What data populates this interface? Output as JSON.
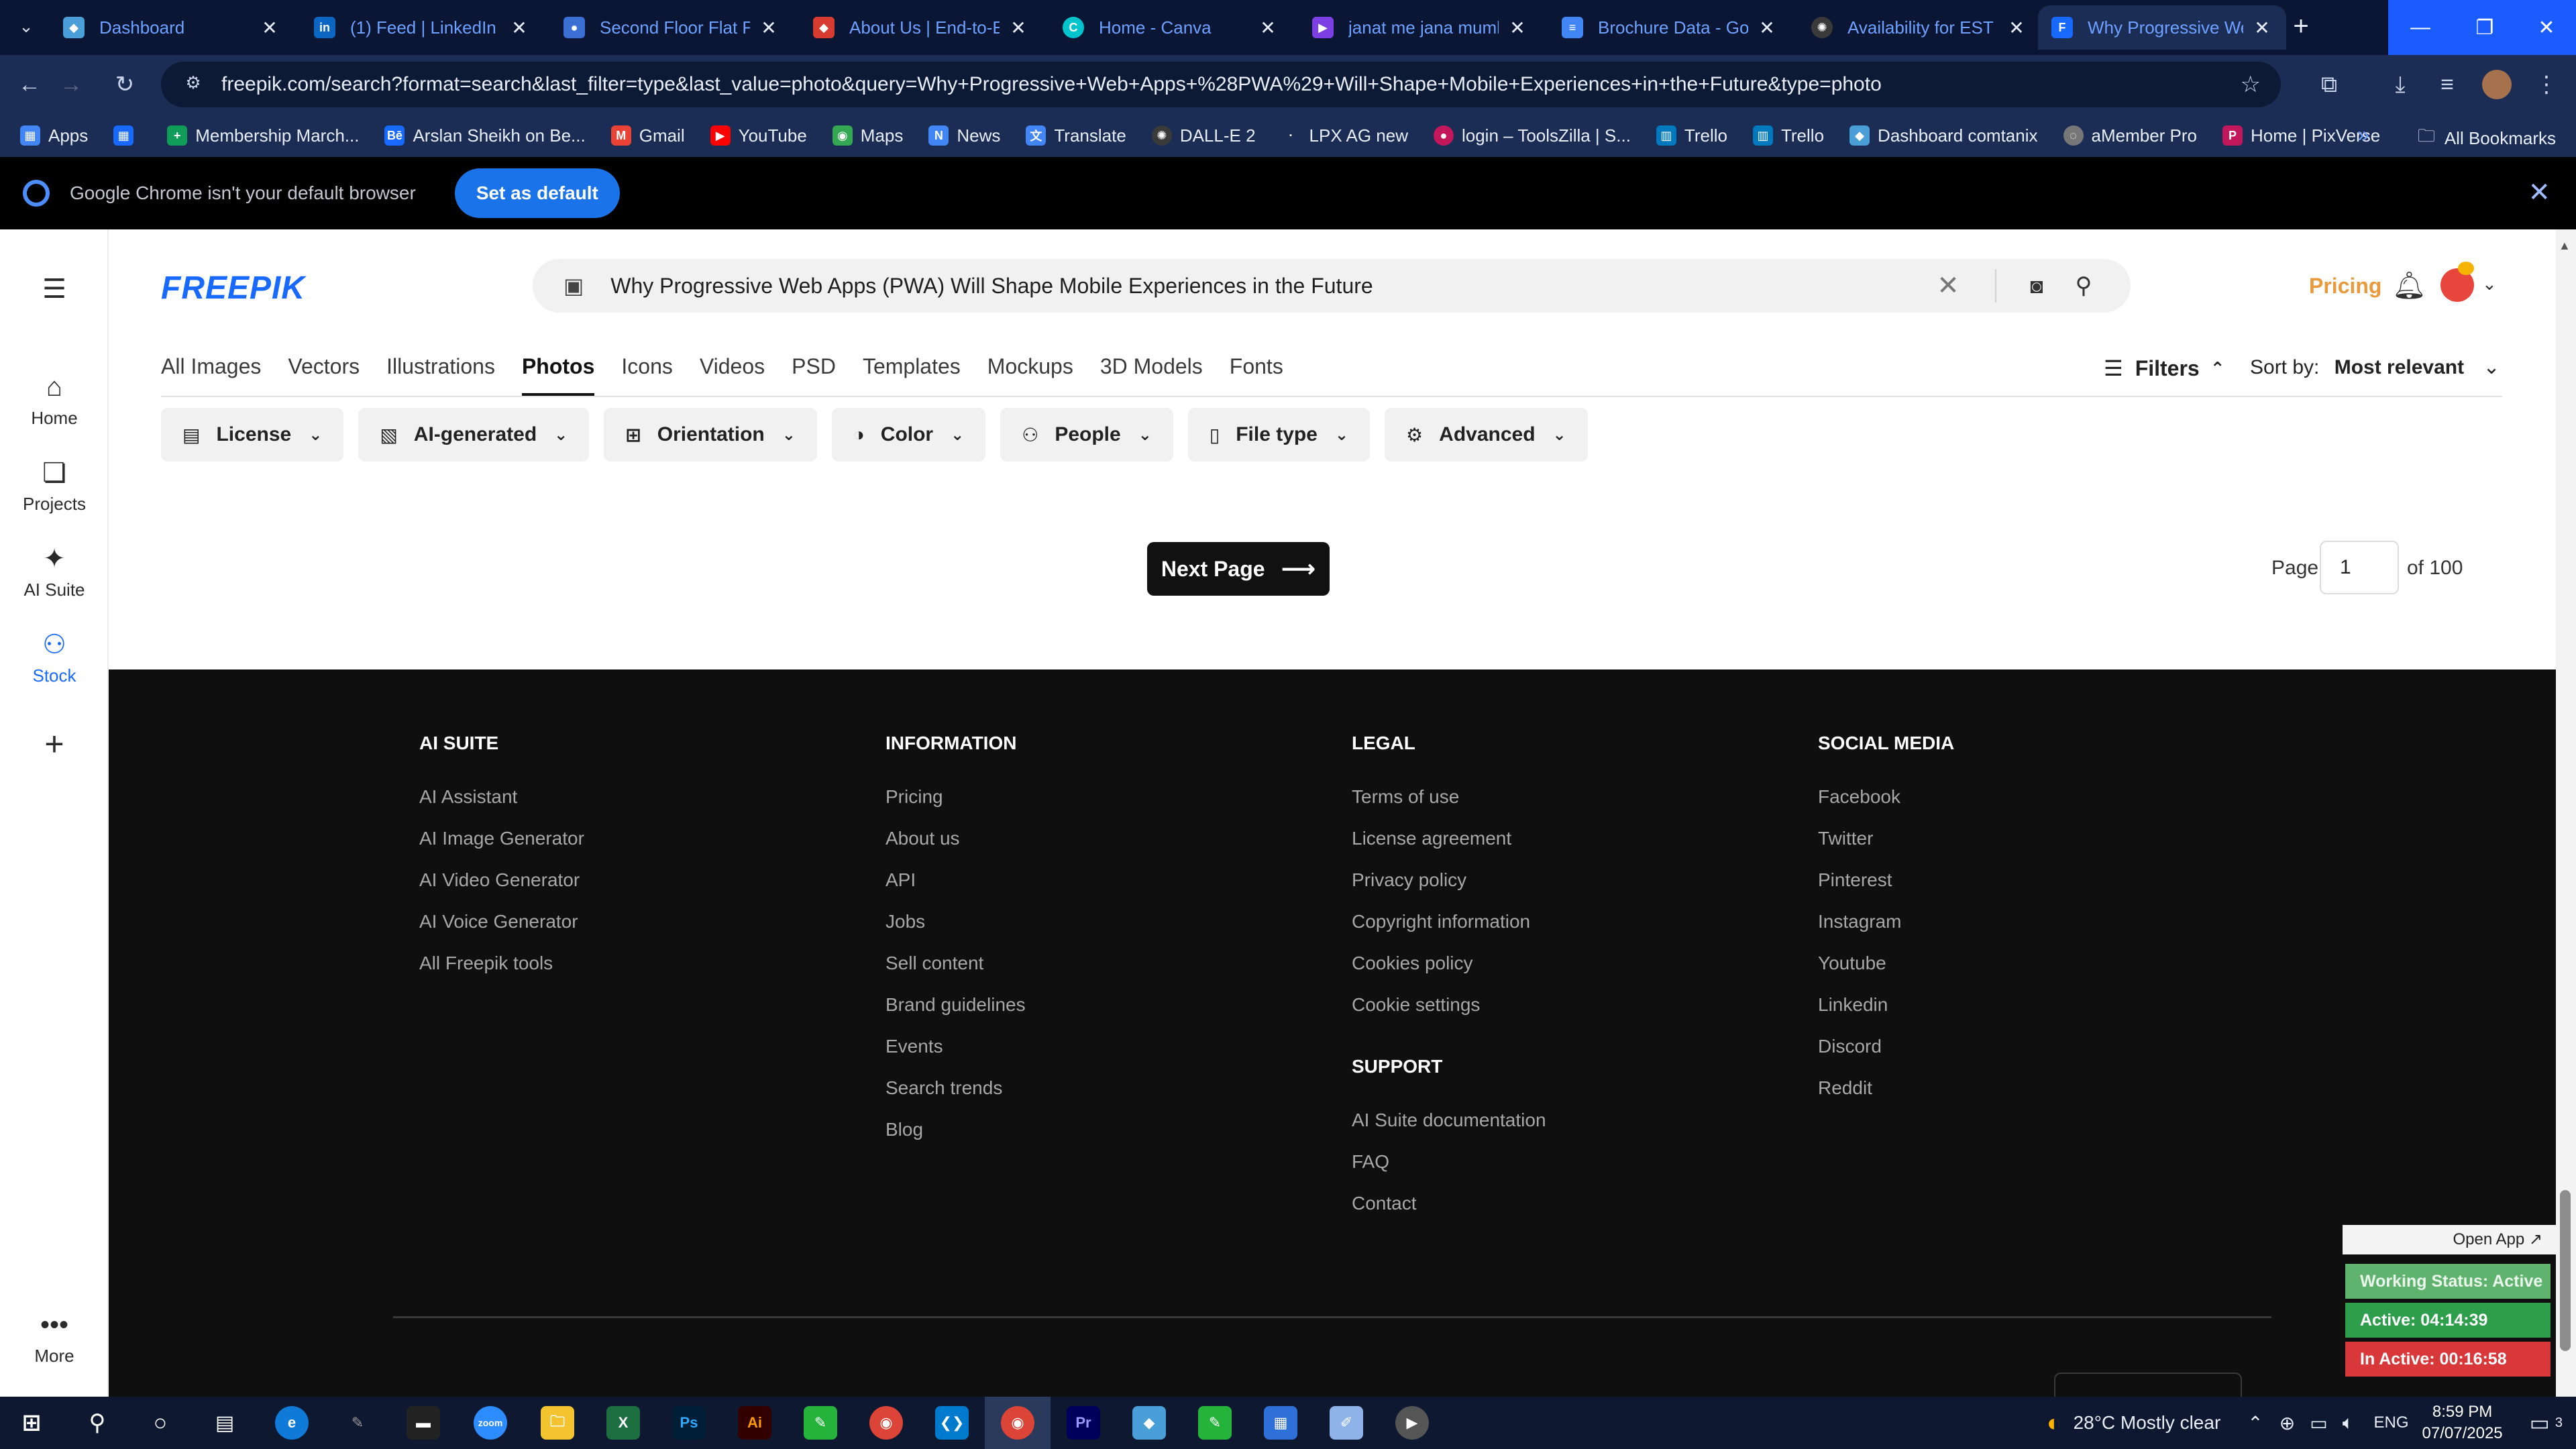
{
  "browser": {
    "tabs": [
      {
        "title": "Dashboard",
        "icon": "dashboard-favicon",
        "color": "#4a9fd8"
      },
      {
        "title": "(1) Feed | LinkedIn",
        "icon": "linkedin-favicon",
        "color": "#0a66c2"
      },
      {
        "title": "Second Floor Flat For",
        "icon": "listing-favicon",
        "color": "#3b6fd4"
      },
      {
        "title": "About Us | End-to-En",
        "icon": "site-favicon",
        "color": "#d83b2f"
      },
      {
        "title": "Home - Canva",
        "icon": "canva-favicon",
        "color": "#00c4cc"
      },
      {
        "title": "janat me jana mumki",
        "icon": "video-favicon",
        "color": "#7b3fe4"
      },
      {
        "title": "Brochure Data - Goo",
        "icon": "docs-favicon",
        "color": "#4285f4"
      },
      {
        "title": "Availability for EST sh",
        "icon": "openai-favicon",
        "color": "#3a3a3a"
      },
      {
        "title": "Why Progressive We",
        "icon": "freepik-favicon",
        "color": "#1769ff"
      }
    ],
    "url": "freepik.com/search?format=search&last_filter=type&last_value=photo&query=Why+Progressive+Web+Apps+%28PWA%29+Will+Shape+Mobile+Experiences+in+the+Future&type=photo",
    "bookmarks": [
      {
        "label": "Apps",
        "icon": "apps-grid-icon",
        "color": "#4285f4"
      },
      {
        "label": "",
        "icon": "grid-icon",
        "color": "#1769ff"
      },
      {
        "label": "Membership March...",
        "icon": "membership-icon",
        "color": "#0f9d58"
      },
      {
        "label": "Arslan Sheikh on Be...",
        "icon": "behance-icon",
        "color": "#1769ff"
      },
      {
        "label": "Gmail",
        "icon": "gmail-icon",
        "color": "#ea4335"
      },
      {
        "label": "YouTube",
        "icon": "youtube-icon",
        "color": "#ff0000"
      },
      {
        "label": "Maps",
        "icon": "maps-icon",
        "color": "#34a853"
      },
      {
        "label": "News",
        "icon": "news-icon",
        "color": "#4285f4"
      },
      {
        "label": "Translate",
        "icon": "translate-icon",
        "color": "#4285f4"
      },
      {
        "label": "DALL-E 2",
        "icon": "openai-icon",
        "color": "#3a3a3a"
      },
      {
        "label": "LPX AG new",
        "icon": "lpx-icon",
        "color": "#1b2d55"
      },
      {
        "label": "login – ToolsZilla | S...",
        "icon": "toolszilla-icon",
        "color": "#c2185b"
      },
      {
        "label": "Trello",
        "icon": "trello-icon",
        "color": "#0079bf"
      },
      {
        "label": "Trello",
        "icon": "trello-icon",
        "color": "#0079bf"
      },
      {
        "label": "Dashboard comtanix",
        "icon": "dashboard-icon",
        "color": "#4a9fd8"
      },
      {
        "label": "aMember Pro",
        "icon": "amember-icon",
        "color": "#777777"
      },
      {
        "label": "Home | PixVerse",
        "icon": "pixverse-icon",
        "color": "#c2185b"
      }
    ],
    "all_bookmarks": "All Bookmarks",
    "infobar": {
      "message": "Google Chrome isn't your default browser",
      "button": "Set as default"
    }
  },
  "rail": {
    "items": [
      {
        "label": "Home",
        "icon": "home-icon"
      },
      {
        "label": "Projects",
        "icon": "projects-icon"
      },
      {
        "label": "AI Suite",
        "icon": "ai-sparkle-icon"
      },
      {
        "label": "Stock",
        "icon": "stock-icon"
      }
    ],
    "add_icon": "plus-icon",
    "more_label": "More"
  },
  "header": {
    "logo": "FREEPIK",
    "search_query": "Why Progressive Web Apps (PWA) Will Shape Mobile Experiences in the Future",
    "pricing": "Pricing"
  },
  "categories": [
    "All Images",
    "Vectors",
    "Illustrations",
    "Photos",
    "Icons",
    "Videos",
    "PSD",
    "Templates",
    "Mockups",
    "3D Models",
    "Fonts"
  ],
  "active_category": "Photos",
  "filters_label": "Filters",
  "sort": {
    "label": "Sort by:",
    "value": "Most relevant"
  },
  "chips": [
    {
      "label": "License",
      "icon": "license-icon"
    },
    {
      "label": "AI-generated",
      "icon": "ai-generated-icon"
    },
    {
      "label": "Orientation",
      "icon": "orientation-icon"
    },
    {
      "label": "Color",
      "icon": "palette-icon"
    },
    {
      "label": "People",
      "icon": "people-icon"
    },
    {
      "label": "File type",
      "icon": "file-icon"
    },
    {
      "label": "Advanced",
      "icon": "advanced-gear-icon"
    }
  ],
  "pagination": {
    "next_label": "Next Page",
    "page_label": "Page",
    "current": "1",
    "of_label": "of 100"
  },
  "footer": {
    "columns": [
      {
        "heading": "AI SUITE",
        "links": [
          "AI Assistant",
          "AI Image Generator",
          "AI Video Generator",
          "AI Voice Generator",
          "All Freepik tools"
        ]
      },
      {
        "heading": "INFORMATION",
        "links": [
          "Pricing",
          "About us",
          "API",
          "Jobs",
          "Sell content",
          "Brand guidelines",
          "Events",
          "Search trends",
          "Blog"
        ]
      },
      {
        "heading": "LEGAL",
        "links": [
          "Terms of use",
          "License agreement",
          "Privacy policy",
          "Copyright information",
          "Cookies policy",
          "Cookie settings"
        ]
      },
      {
        "heading": "SUPPORT",
        "links": [
          "AI Suite documentation",
          "FAQ",
          "Contact"
        ]
      },
      {
        "heading": "SOCIAL MEDIA",
        "links": [
          "Facebook",
          "Twitter",
          "Pinterest",
          "Instagram",
          "Youtube",
          "Linkedin",
          "Discord",
          "Reddit"
        ]
      }
    ]
  },
  "work_widget": {
    "open_app": "Open App ↗",
    "status": "Working Status: Active",
    "active": "Active: 04:14:39",
    "inactive": "In Active: 00:16:58"
  },
  "taskbar": {
    "apps": [
      {
        "name": "windows-start",
        "color": "#ffffff"
      },
      {
        "name": "search",
        "color": "#ffffff"
      },
      {
        "name": "cortana",
        "color": "#ffffff"
      },
      {
        "name": "task-view",
        "color": "#ffffff"
      },
      {
        "name": "edge",
        "color": "#0f7ad8"
      },
      {
        "name": "pen",
        "color": "#999999"
      },
      {
        "name": "terminal",
        "color": "#222222"
      },
      {
        "name": "zoom",
        "color": "#2d8cff"
      },
      {
        "name": "file-explorer",
        "color": "#f4c430"
      },
      {
        "name": "excel",
        "color": "#1d6f42"
      },
      {
        "name": "photoshop",
        "color": "#001e36"
      },
      {
        "name": "illustrator",
        "color": "#330000"
      },
      {
        "name": "green-app",
        "color": "#25b33b"
      },
      {
        "name": "chrome",
        "color": "#db4437"
      },
      {
        "name": "vscode",
        "color": "#007acc"
      },
      {
        "name": "chrome-active",
        "color": "#db4437"
      },
      {
        "name": "premiere",
        "color": "#00005b"
      },
      {
        "name": "cube-app",
        "color": "#4a9fd8"
      },
      {
        "name": "green-app-2",
        "color": "#25b33b"
      },
      {
        "name": "calculator",
        "color": "#2f6fd8"
      },
      {
        "name": "pen-app",
        "color": "#8fb3e8"
      },
      {
        "name": "player",
        "color": "#555555"
      }
    ],
    "weather": "28°C  Mostly clear",
    "lang": "ENG",
    "time": "8:59 PM",
    "date": "07/07/2025",
    "notif_count": "3"
  }
}
